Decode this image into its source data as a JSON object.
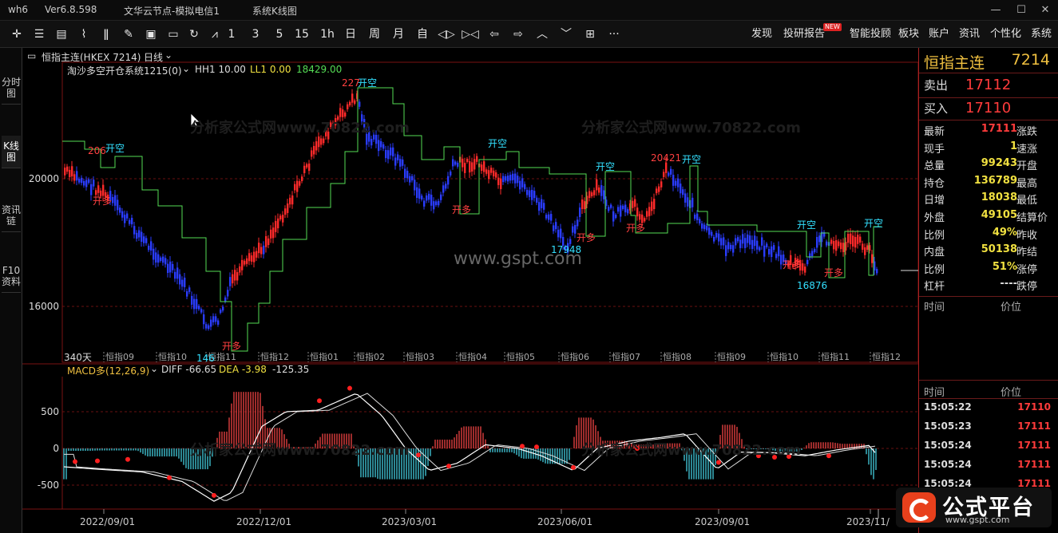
{
  "window": {
    "app": "wh6",
    "version": "Ver6.8.598",
    "node": "文华云节点-模拟电信1",
    "mode": "系统K线图"
  },
  "toolbar": {
    "periods": [
      "1",
      "3",
      "5",
      "15",
      "1h",
      "日",
      "周",
      "月",
      "自"
    ],
    "menu": [
      {
        "label": "发现"
      },
      {
        "label": "投研报告",
        "badge": "NEW"
      },
      {
        "label": "智能投顾"
      },
      {
        "label": "板块"
      },
      {
        "label": "账户"
      },
      {
        "label": "资讯"
      },
      {
        "label": "个性化"
      },
      {
        "label": "系统"
      }
    ],
    "more": "···"
  },
  "sidetabs": [
    "分时图",
    "K线图",
    "资讯链",
    "F10资料"
  ],
  "chart": {
    "symbol_label": "恒指主连(HKEX 7214)",
    "period_label": "日线",
    "indicator_label": "淘沙多空开仓系统1215(0)",
    "hh1_label": "HH1 10.00",
    "ll1_label": "LL1 0.00",
    "level_label": "18429.00",
    "days_label": "340天",
    "watermark": "www.gspt.com",
    "watermark_repeat": "分析家公式网www.70822.com",
    "y_ticks": [
      20000,
      16000
    ],
    "contract_labels": [
      "恒指09",
      "恒指10",
      "恒指11",
      "恒指12",
      "恒指01",
      "恒指02",
      "恒指03",
      "恒指04",
      "恒指05",
      "恒指06",
      "恒指07",
      "恒指08",
      "恒指09",
      "恒指10",
      "恒指11",
      "恒指12"
    ],
    "price_annotations": [
      "206",
      "227",
      "20421",
      "17948",
      "16876",
      "146"
    ],
    "signal_open_short": "开空",
    "signal_open_long": "开多",
    "date_labels": [
      "2022/09/01",
      "2022/12/01",
      "2023/03/01",
      "2023/06/01",
      "2023/09/01",
      "2023/11/"
    ]
  },
  "macd": {
    "label": "MACD多(12,26,9)",
    "diff": "DIFF -66.65",
    "dea": "DEA -3.98",
    "macd_value": "-125.35",
    "y_ticks": [
      "500",
      "0",
      "-500"
    ]
  },
  "quote": {
    "name": "恒指主连",
    "code": "7214",
    "sell_label": "卖出",
    "sell_price": "17112",
    "buy_label": "买入",
    "buy_price": "17110",
    "rows": [
      {
        "label": "最新",
        "value": "17111",
        "right": "涨跌",
        "color": "#ff3b3b"
      },
      {
        "label": "现手",
        "value": "1",
        "right": "速涨",
        "color": "#f0e040"
      },
      {
        "label": "总量",
        "value": "99243",
        "right": "开盘",
        "color": "#f0e040"
      },
      {
        "label": "持仓",
        "value": "136789",
        "right": "最高",
        "color": "#f0e040"
      },
      {
        "label": "日增",
        "value": "18038",
        "right": "最低",
        "color": "#f0e040"
      },
      {
        "label": "外盘",
        "value": "49105",
        "right": "结算价",
        "color": "#f0e040"
      },
      {
        "label": "比例",
        "value": "49%",
        "right": "昨收",
        "color": "#f0e040"
      },
      {
        "label": "内盘",
        "value": "50138",
        "right": "昨结",
        "color": "#f0e040"
      },
      {
        "label": "比例",
        "value": "51%",
        "right": "涨停",
        "color": "#f0e040"
      },
      {
        "label": "杠杆",
        "value": "----",
        "right": "跌停",
        "color": "#ddd"
      }
    ],
    "col_time": "时间",
    "col_price": "价位",
    "ticks": [
      {
        "time": "15:05:22",
        "price": "17110"
      },
      {
        "time": "15:05:23",
        "price": "17111"
      },
      {
        "time": "15:05:24",
        "price": "17111"
      },
      {
        "time": "15:05:24",
        "price": "17111"
      },
      {
        "time": "15:05:24",
        "price": "17111"
      }
    ]
  },
  "logo": {
    "text": "公式平台",
    "url": "www.gspt.com"
  },
  "colors": {
    "up": "#ff2a2a",
    "down": "#2a3cff",
    "stop": "#55dd55",
    "short_text": "#33e0ff",
    "long_text": "#ff4040",
    "grid": "#6a1010",
    "macd_pos": "#e04040",
    "macd_neg": "#40c0d0"
  }
}
